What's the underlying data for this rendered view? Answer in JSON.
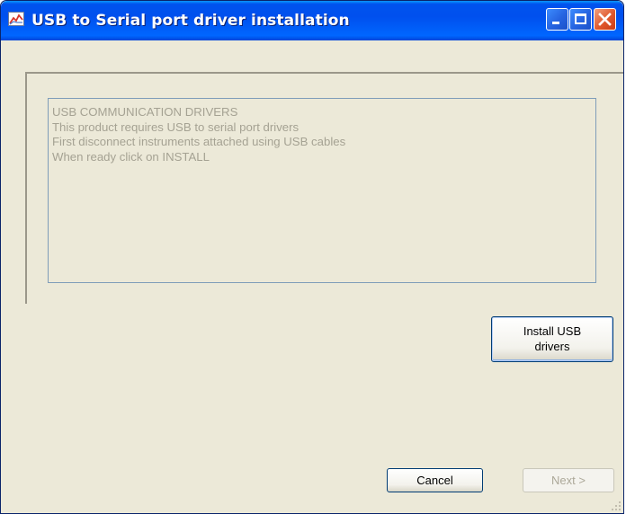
{
  "window": {
    "title": "USB to Serial port driver installation",
    "icon": "chart-app-icon",
    "controls": [
      "minimize-icon",
      "maximize-icon",
      "close-icon"
    ]
  },
  "info": {
    "lines": [
      "USB COMMUNICATION DRIVERS",
      "This product requires USB to serial port drivers",
      "First disconnect instruments attached using USB cables",
      "When ready click on INSTALL"
    ]
  },
  "buttons": {
    "install_line1": "Install USB",
    "install_line2": "drivers",
    "cancel": "Cancel",
    "next": "Next >"
  },
  "colors": {
    "titlebar": "#0050ee",
    "face": "#ece9d8",
    "disabled_text": "#a5a293"
  }
}
